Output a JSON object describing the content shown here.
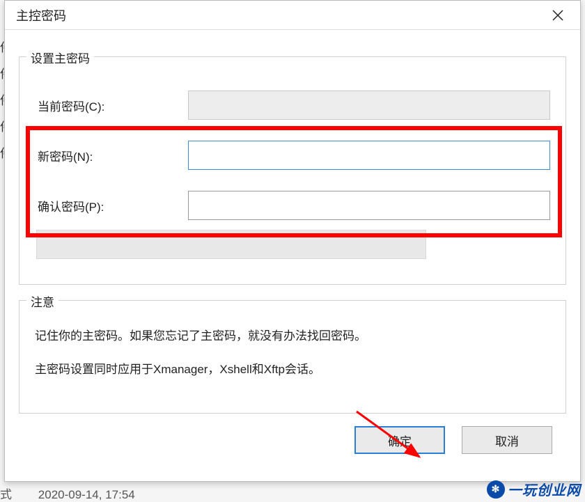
{
  "dialog": {
    "title": "主控密码",
    "close_label": "Close"
  },
  "group": {
    "title": "设置主密码",
    "fields": {
      "current": {
        "label": "当前密码(C):",
        "value": ""
      },
      "new": {
        "label": "新密码(N):",
        "value": ""
      },
      "confirm": {
        "label": "确认密码(P):",
        "value": ""
      }
    }
  },
  "note": {
    "title": "注意",
    "line1": "记住你的主密码。如果您忘记了主密码，就没有办法找回密码。",
    "line2": "主密码设置同时应用于Xmanager，Xshell和Xftp会话。"
  },
  "buttons": {
    "ok": "确定",
    "cancel": "取消"
  },
  "background": {
    "side_char": "件",
    "side_char2": "式",
    "timestamp": "2020-09-14, 17:54"
  },
  "watermark": {
    "text": "一玩创业网"
  }
}
